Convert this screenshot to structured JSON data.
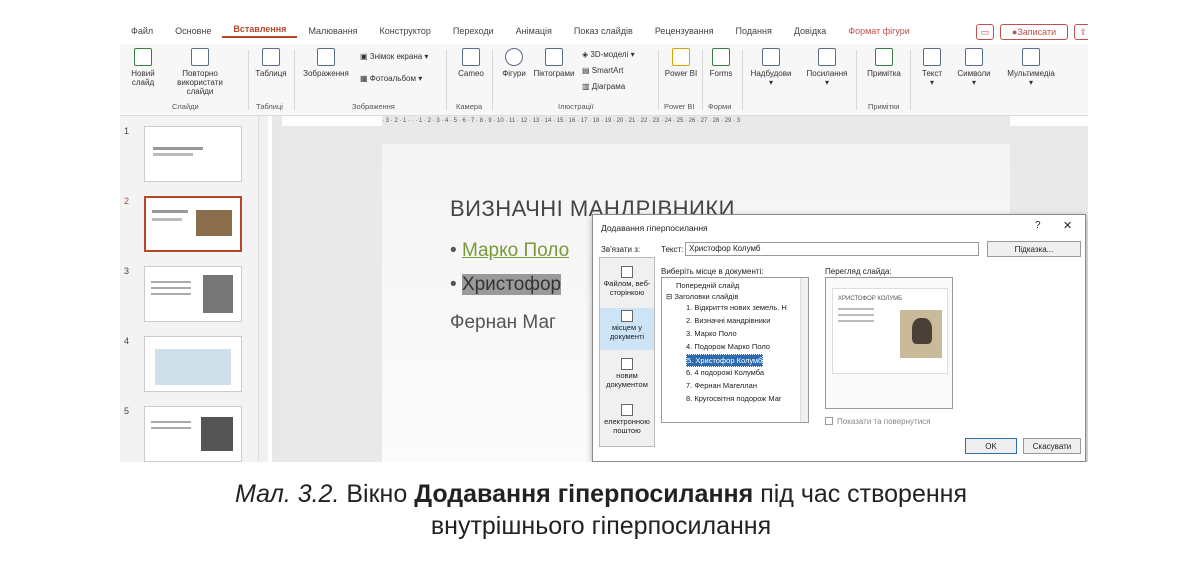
{
  "ribbon_tabs": [
    "Файл",
    "Основне",
    "Вставлення",
    "Малювання",
    "Конструктор",
    "Переходи",
    "Анімація",
    "Показ слайдів",
    "Рецензування",
    "Подання",
    "Довідка",
    "Формат фігури"
  ],
  "record_label": "Записати",
  "ribbon_buttons": {
    "new_slide": "Новий слайд",
    "reuse_slides": "Повторно використати слайди",
    "table": "Таблиця",
    "images": "Зображення",
    "screenshot": "Знімок екрана",
    "photo_album": "Фотоальбом",
    "cameo": "Cameo",
    "shapes": "Фігури",
    "icons": "Піктограми",
    "models_3d": "3D-моделі",
    "smartart": "SmartArt",
    "chart": "Діаграма",
    "power_bi": "Power BI",
    "forms": "Forms",
    "addins": "Надбудови",
    "links": "Посилання",
    "comment": "Примітка",
    "text": "Текст",
    "symbols": "Символи",
    "multimedia": "Мультимедіа"
  },
  "ribbon_groups": {
    "slides": "Слайди",
    "tables": "Таблиці",
    "images": "Зображення",
    "camera": "Камера",
    "illustrations": "Ілюстрації",
    "power_bi": "Power BI",
    "forms": "Форми",
    "comments": "Примітки"
  },
  "slide_numbers": [
    "1",
    "2",
    "3",
    "4",
    "5"
  ],
  "slide": {
    "title": "ВИЗНАЧНІ МАНДРІВНИКИ",
    "bullets": [
      "Марко Поло",
      "Христофор",
      "Фернан Маг"
    ]
  },
  "dialog": {
    "title": "Додавання гіперпосилання",
    "help": "?",
    "close": "✕",
    "link_to_label": "Зв'язати з:",
    "text_label": "Текст:",
    "text_value": "Христофор Колумб",
    "screen_tip": "Підказка...",
    "place_label": "Виберіть місце в документі:",
    "preview_label": "Перегляд слайда:",
    "link_options": [
      "Файлом, веб-сторінкою",
      "місцем у документі",
      "новим документом",
      "електронною поштою"
    ],
    "tree": [
      "Попередній слайд",
      "Заголовки слайдів",
      "1. Відкриття нових земель. Н",
      "2. Визначні мандрівники",
      "3. Марко Поло",
      "4. Подорож Марко Поло",
      "5. Христофор Колумб",
      "6. 4 подорожі Колумба",
      "7. Фернан Магеллан",
      "8. Кругосвітня подорож Маг"
    ],
    "preview_title": "ХРИСТОФОР КОЛУМБ",
    "show_and_return": "Показати та повернутися",
    "ok": "OK",
    "cancel": "Скасувати"
  },
  "caption": {
    "prefix": "Мал. 3.2.",
    "text1": "Вікно",
    "bold": "Додавання гіперпосилання",
    "text2": "під час створення",
    "line2": "внутрішнього гіперпосилання"
  }
}
